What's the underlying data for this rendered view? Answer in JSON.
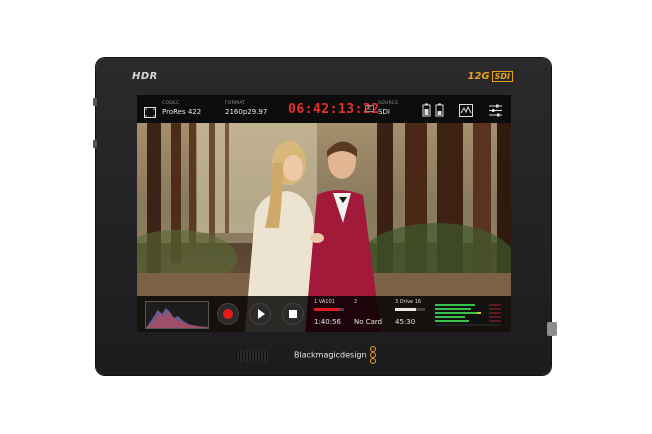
{
  "device": {
    "hdr_logo": "HDR",
    "sdi_logo_main": "12G",
    "sdi_logo_box": "SDI",
    "brand": "Blackmagicdesign"
  },
  "topbar": {
    "codec_label": "CODEC",
    "codec_value": "ProRes 422",
    "format_label": "FORMAT",
    "format_value": "2160p29.97",
    "timecode": "06:42:13:22",
    "tc_badge": "TC",
    "source_label": "SOURCE",
    "source_value": "SDI"
  },
  "bottombar": {
    "slot1_name": "1  VA101",
    "slot1_time": "1:40:56",
    "slot1_fill": 0.85,
    "slot2_name": "2",
    "slot2_status": "No Card",
    "slot3_name": "3  Drive 16",
    "slot3_time": "45:30",
    "slot3_fill": 0.7
  },
  "colors": {
    "record_red": "#e21c1c",
    "timecode_red": "#ea2d2d",
    "sdi_gold": "#e7a21c",
    "meter_green": "#39c14a"
  }
}
